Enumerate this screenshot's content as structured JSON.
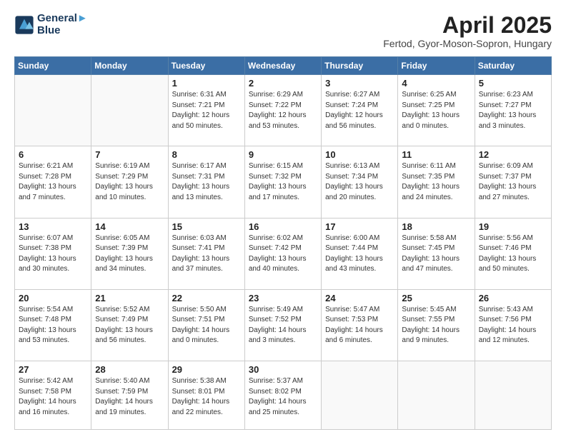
{
  "logo": {
    "line1": "General",
    "line2": "Blue"
  },
  "title": "April 2025",
  "location": "Fertod, Gyor-Moson-Sopron, Hungary",
  "weekdays": [
    "Sunday",
    "Monday",
    "Tuesday",
    "Wednesday",
    "Thursday",
    "Friday",
    "Saturday"
  ],
  "weeks": [
    [
      {
        "day": "",
        "info": ""
      },
      {
        "day": "",
        "info": ""
      },
      {
        "day": "1",
        "info": "Sunrise: 6:31 AM\nSunset: 7:21 PM\nDaylight: 12 hours and 50 minutes."
      },
      {
        "day": "2",
        "info": "Sunrise: 6:29 AM\nSunset: 7:22 PM\nDaylight: 12 hours and 53 minutes."
      },
      {
        "day": "3",
        "info": "Sunrise: 6:27 AM\nSunset: 7:24 PM\nDaylight: 12 hours and 56 minutes."
      },
      {
        "day": "4",
        "info": "Sunrise: 6:25 AM\nSunset: 7:25 PM\nDaylight: 13 hours and 0 minutes."
      },
      {
        "day": "5",
        "info": "Sunrise: 6:23 AM\nSunset: 7:27 PM\nDaylight: 13 hours and 3 minutes."
      }
    ],
    [
      {
        "day": "6",
        "info": "Sunrise: 6:21 AM\nSunset: 7:28 PM\nDaylight: 13 hours and 7 minutes."
      },
      {
        "day": "7",
        "info": "Sunrise: 6:19 AM\nSunset: 7:29 PM\nDaylight: 13 hours and 10 minutes."
      },
      {
        "day": "8",
        "info": "Sunrise: 6:17 AM\nSunset: 7:31 PM\nDaylight: 13 hours and 13 minutes."
      },
      {
        "day": "9",
        "info": "Sunrise: 6:15 AM\nSunset: 7:32 PM\nDaylight: 13 hours and 17 minutes."
      },
      {
        "day": "10",
        "info": "Sunrise: 6:13 AM\nSunset: 7:34 PM\nDaylight: 13 hours and 20 minutes."
      },
      {
        "day": "11",
        "info": "Sunrise: 6:11 AM\nSunset: 7:35 PM\nDaylight: 13 hours and 24 minutes."
      },
      {
        "day": "12",
        "info": "Sunrise: 6:09 AM\nSunset: 7:37 PM\nDaylight: 13 hours and 27 minutes."
      }
    ],
    [
      {
        "day": "13",
        "info": "Sunrise: 6:07 AM\nSunset: 7:38 PM\nDaylight: 13 hours and 30 minutes."
      },
      {
        "day": "14",
        "info": "Sunrise: 6:05 AM\nSunset: 7:39 PM\nDaylight: 13 hours and 34 minutes."
      },
      {
        "day": "15",
        "info": "Sunrise: 6:03 AM\nSunset: 7:41 PM\nDaylight: 13 hours and 37 minutes."
      },
      {
        "day": "16",
        "info": "Sunrise: 6:02 AM\nSunset: 7:42 PM\nDaylight: 13 hours and 40 minutes."
      },
      {
        "day": "17",
        "info": "Sunrise: 6:00 AM\nSunset: 7:44 PM\nDaylight: 13 hours and 43 minutes."
      },
      {
        "day": "18",
        "info": "Sunrise: 5:58 AM\nSunset: 7:45 PM\nDaylight: 13 hours and 47 minutes."
      },
      {
        "day": "19",
        "info": "Sunrise: 5:56 AM\nSunset: 7:46 PM\nDaylight: 13 hours and 50 minutes."
      }
    ],
    [
      {
        "day": "20",
        "info": "Sunrise: 5:54 AM\nSunset: 7:48 PM\nDaylight: 13 hours and 53 minutes."
      },
      {
        "day": "21",
        "info": "Sunrise: 5:52 AM\nSunset: 7:49 PM\nDaylight: 13 hours and 56 minutes."
      },
      {
        "day": "22",
        "info": "Sunrise: 5:50 AM\nSunset: 7:51 PM\nDaylight: 14 hours and 0 minutes."
      },
      {
        "day": "23",
        "info": "Sunrise: 5:49 AM\nSunset: 7:52 PM\nDaylight: 14 hours and 3 minutes."
      },
      {
        "day": "24",
        "info": "Sunrise: 5:47 AM\nSunset: 7:53 PM\nDaylight: 14 hours and 6 minutes."
      },
      {
        "day": "25",
        "info": "Sunrise: 5:45 AM\nSunset: 7:55 PM\nDaylight: 14 hours and 9 minutes."
      },
      {
        "day": "26",
        "info": "Sunrise: 5:43 AM\nSunset: 7:56 PM\nDaylight: 14 hours and 12 minutes."
      }
    ],
    [
      {
        "day": "27",
        "info": "Sunrise: 5:42 AM\nSunset: 7:58 PM\nDaylight: 14 hours and 16 minutes."
      },
      {
        "day": "28",
        "info": "Sunrise: 5:40 AM\nSunset: 7:59 PM\nDaylight: 14 hours and 19 minutes."
      },
      {
        "day": "29",
        "info": "Sunrise: 5:38 AM\nSunset: 8:01 PM\nDaylight: 14 hours and 22 minutes."
      },
      {
        "day": "30",
        "info": "Sunrise: 5:37 AM\nSunset: 8:02 PM\nDaylight: 14 hours and 25 minutes."
      },
      {
        "day": "",
        "info": ""
      },
      {
        "day": "",
        "info": ""
      },
      {
        "day": "",
        "info": ""
      }
    ]
  ]
}
